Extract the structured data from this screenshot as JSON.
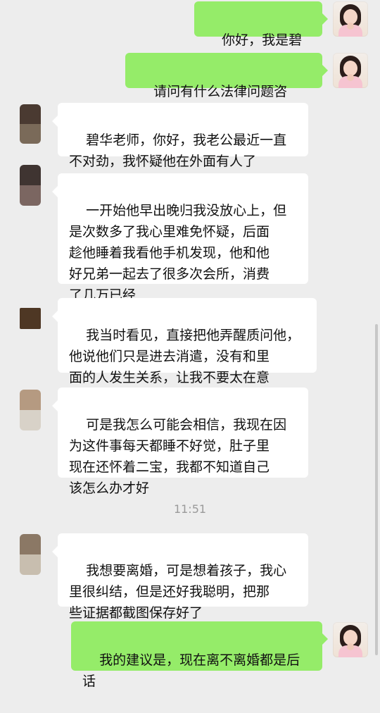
{
  "messages": [
    {
      "side": "out",
      "text": "你好，我是碧华"
    },
    {
      "side": "out",
      "text": "请问有什么法律问题咨询？"
    },
    {
      "side": "in",
      "text": "碧华老师，你好，我老公最近一直\n不对劲，我怀疑他在外面有人了"
    },
    {
      "side": "in",
      "text": "一开始他早出晚归我没放心上，但\n是次数多了我心里难免怀疑，后面\n趁他睡着我看他手机发现，他和他\n好兄弟一起去了很多次会所，消费\n了几万已经"
    },
    {
      "side": "in",
      "text": "我当时看见，直接把他弄醒质问他，\n他说他们只是进去消遣，没有和里\n面的人发生关系，让我不要太在意"
    },
    {
      "side": "in",
      "text": "可是我怎么可能会相信，我现在因\n为这件事每天都睡不好觉，肚子里\n现在还怀着二宝，我都不知道自己\n该怎么办才好"
    },
    {
      "side": "in",
      "text": "我想要离婚，可是想着孩子，我心\n里很纠结，但是还好我聪明，把那\n些证据都截图保存好了"
    },
    {
      "side": "out",
      "text": "我的建议是，现在离不离婚都是后\n话"
    }
  ],
  "timestamp": "11:51",
  "colors": {
    "background": "#ededed",
    "incoming_bubble": "#ffffff",
    "outgoing_bubble": "#95ec69",
    "timestamp_text": "#9a9a9a"
  },
  "avatars": {
    "self": "woman-portrait-avatar",
    "other": "blurred-user-avatar"
  }
}
